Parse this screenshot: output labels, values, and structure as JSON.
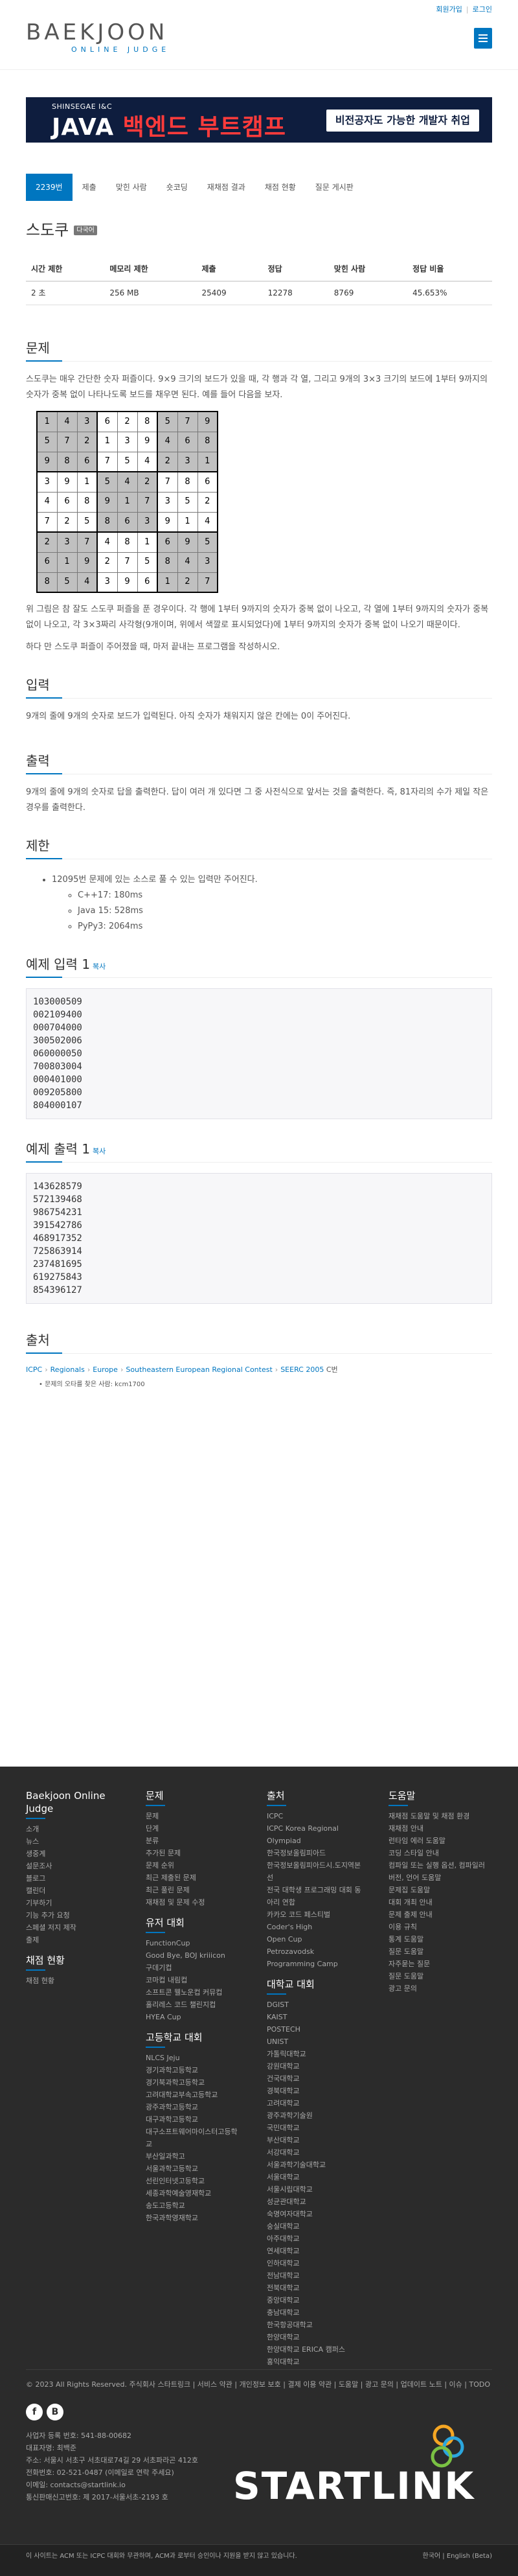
{
  "header": {
    "logo_text": "BAEKJOON",
    "logo_sub": "ONLINE JUDGE",
    "top_links": [
      "회원가입",
      "로그인"
    ]
  },
  "banner": {
    "brand": "SHINSEGAE I&C",
    "title_part1": "JAVA ",
    "title_part2": "백엔드 부트캠프",
    "cta": "비전공자도 가능한 개발자 취업"
  },
  "tabs": [
    "2239번",
    "제출",
    "맞힌 사람",
    "숏코딩",
    "재채점 결과",
    "채점 현황",
    "질문 게시판"
  ],
  "problem": {
    "title": "스도쿠",
    "badge": "다국어",
    "info_headers": [
      "시간 제한",
      "메모리 제한",
      "제출",
      "정답",
      "맞힌 사람",
      "정답 비율"
    ],
    "info_values": [
      "2 초",
      "256 MB",
      "25409",
      "12278",
      "8769",
      "45.653%"
    ]
  },
  "sections": {
    "desc_title": "문제",
    "desc_p1": "스도쿠는 매우 간단한 숫자 퍼즐이다. 9×9 크기의 보드가 있을 때, 각 행과 각 열, 그리고 9개의 3×3 크기의 보드에 1부터 9까지의 숫자가 중복 없이 나타나도록 보드를 채우면 된다. 예를 들어 다음을 보자.",
    "desc_p2": "위 그림은 참 잘도 스도쿠 퍼즐을 푼 경우이다. 각 행에 1부터 9까지의 숫자가 중복 없이 나오고, 각 열에 1부터 9까지의 숫자가 중복 없이 나오고, 각 3×3짜리 사각형(9개이며, 위에서 색깔로 표시되었다)에 1부터 9까지의 숫자가 중복 없이 나오기 때문이다.",
    "desc_p3": "하다 만 스도쿠 퍼즐이 주어졌을 때, 마저 끝내는 프로그램을 작성하시오.",
    "input_title": "입력",
    "input_text": "9개의 줄에 9개의 숫자로 보드가 입력된다. 아직 숫자가 채워지지 않은 칸에는 0이 주어진다.",
    "output_title": "출력",
    "output_text": "9개의 줄에 9개의 숫자로 답을 출력한다. 답이 여러 개 있다면 그 중 사전식으로 앞서는 것을 출력한다. 즉, 81자리의 수가 제일 작은 경우를 출력한다.",
    "limit_title": "제한",
    "limit_main": "12095번 문제에 있는 소스로 풀 수 있는 입력만 주어진다.",
    "limit_items": [
      "C++17: 180ms",
      "Java 15: 528ms",
      "PyPy3: 2064ms"
    ],
    "sample_in_title": "예제 입력 1",
    "sample_out_title": "예제 출력 1",
    "copy_label": "복사",
    "sample_input": "103000509\n002109400\n000704000\n300502006\n060000050\n700803004\n000401000\n009205800\n804000107",
    "sample_output": "143628579\n572139468\n986754231\n391542786\n468917352\n725863914\n237481695\n619275843\n854396127",
    "source_title": "출처",
    "source_path": [
      "ICPC",
      "Regionals",
      "Europe",
      "Southeastern European Regional Contest",
      "SEERC 2005"
    ],
    "source_suffix": "C번",
    "source_sub": "문제의 오타를 찾은 사람: kcm1700"
  },
  "sudoku": [
    [
      1,
      4,
      3,
      6,
      2,
      8,
      5,
      7,
      9
    ],
    [
      5,
      7,
      2,
      1,
      3,
      9,
      4,
      6,
      8
    ],
    [
      9,
      8,
      6,
      7,
      5,
      4,
      2,
      3,
      1
    ],
    [
      3,
      9,
      1,
      5,
      4,
      2,
      7,
      8,
      6
    ],
    [
      4,
      6,
      8,
      9,
      1,
      7,
      3,
      5,
      2
    ],
    [
      7,
      2,
      5,
      8,
      6,
      3,
      9,
      1,
      4
    ],
    [
      2,
      3,
      7,
      4,
      8,
      1,
      6,
      9,
      5
    ],
    [
      6,
      1,
      9,
      2,
      7,
      5,
      8,
      4,
      3
    ],
    [
      8,
      5,
      4,
      3,
      9,
      6,
      1,
      2,
      7
    ]
  ],
  "footer": {
    "col1_title": "Baekjoon Online Judge",
    "col1_links": [
      "소개",
      "뉴스",
      "생중계",
      "설문조사",
      "블로그",
      "캘린더",
      "기부하기",
      "기능 추가 요청",
      "스페셜 저지 제작",
      "출제"
    ],
    "col1_title2": "채점 현황",
    "col1_links2": [
      "채점 현황"
    ],
    "col2_title": "문제",
    "col2_links": [
      "문제",
      "단계",
      "분류",
      "추가된 문제",
      "문제 순위",
      "최근 제출된 문제",
      "최근 풀린 문제",
      "재채점 및 문제 수정"
    ],
    "col2_title2": "유저 대회",
    "col2_links2": [
      "FunctionCup",
      "Good Bye, BOJ kriiicon",
      "구데기컵",
      "코마컵 내림컵",
      "소프트콘 웰노운컵 커뮤컵",
      "홀리레스 코드 챌린지컵",
      "HYEA Cup"
    ],
    "col2_title3": "고등학교 대회",
    "col2_links3": [
      "NLCS Jeju",
      "경기과학고등학교",
      "경기북과학고등학교",
      "고려대학교부속고등학교",
      "광주과학고등학교",
      "대구과학고등학교",
      "대구소프트웨어마이스터고등학교",
      "부산일과학고",
      "서울과학고등학교",
      "선린인터넷고등학교",
      "세종과학예술영재학교",
      "송도고등학교",
      "한국과학영재학교"
    ],
    "col3_title": "출처",
    "col3_links": [
      "ICPC",
      "ICPC Korea Regional",
      "Olympiad",
      "한국정보올림피아드",
      "한국정보올림피아드시.도지역본선",
      "전국 대학생 프로그래밍 대회 동아리 연합",
      "카카오 코드 페스티벌",
      "Coder's High",
      "Open Cup",
      "Petrozavodsk",
      "Programming Camp"
    ],
    "col3_title2": "대학교 대회",
    "col3_links2": [
      "DGIST",
      "KAIST",
      "POSTECH",
      "UNIST",
      "가톨릭대학교",
      "강원대학교",
      "건국대학교",
      "경북대학교",
      "고려대학교",
      "광주과학기술원",
      "국민대학교",
      "부산대학교",
      "서강대학교",
      "서울과학기술대학교",
      "서울대학교",
      "서울시립대학교",
      "성균관대학교",
      "숙명여자대학교",
      "숭실대학교",
      "아주대학교",
      "연세대학교",
      "인하대학교",
      "전남대학교",
      "전북대학교",
      "중앙대학교",
      "충남대학교",
      "한국항공대학교",
      "한양대학교",
      "한양대학교 ERICA 캠퍼스",
      "홍익대학교"
    ],
    "col4_title": "도움말",
    "col4_links": [
      "재채점 도움말 및 채점 환경",
      "재채점 안내",
      "런타임 에러 도움말",
      "코딩 스타일 안내",
      "컴파일 또는 실행 옵션, 컴파일러 버전, 언어 도움말",
      "문제집 도움말",
      "대회 개최 안내",
      "문제 출제 안내",
      "이용 규칙",
      "통계 도움말",
      "질문 도움말",
      "자주묻는 질문",
      "질문 도움말",
      "광고 문의"
    ],
    "bottom_links": "© 2023 All Rights Reserved. 주식회사 스타트링크 | 서비스 약관 | 개인정보 보호 | 결제 이용 약관 | 도움말 | 광고 문의 | 업데이트 노트 | 이슈 | TODO",
    "social": [
      "f",
      "B"
    ],
    "company": [
      "사업자 등록 번호: 541-88-00682",
      "대표자명: 최백준",
      "주소: 서울시 서초구 서초대로74길 29 서초파라곤 412호",
      "전화번호: 02-521-0487 (이메일로 연락 주세요)",
      "이메일: contacts@startlink.io",
      "통신판매신고번호: 제 2017-서울서초-2193 호"
    ],
    "startlink": "STARTLINK",
    "copyright": "이 사이트는 ACM 또는 ICPC 대회와 무관하며, ACM과 로부터 승인이나 지원을 받지 않고 있습니다.",
    "lang": "한국어 | English (Beta)"
  },
  "colors": {
    "brand": "#0076c0",
    "footer_bg": "#2b2b2b",
    "banner_bg": "#0e1d3e"
  }
}
